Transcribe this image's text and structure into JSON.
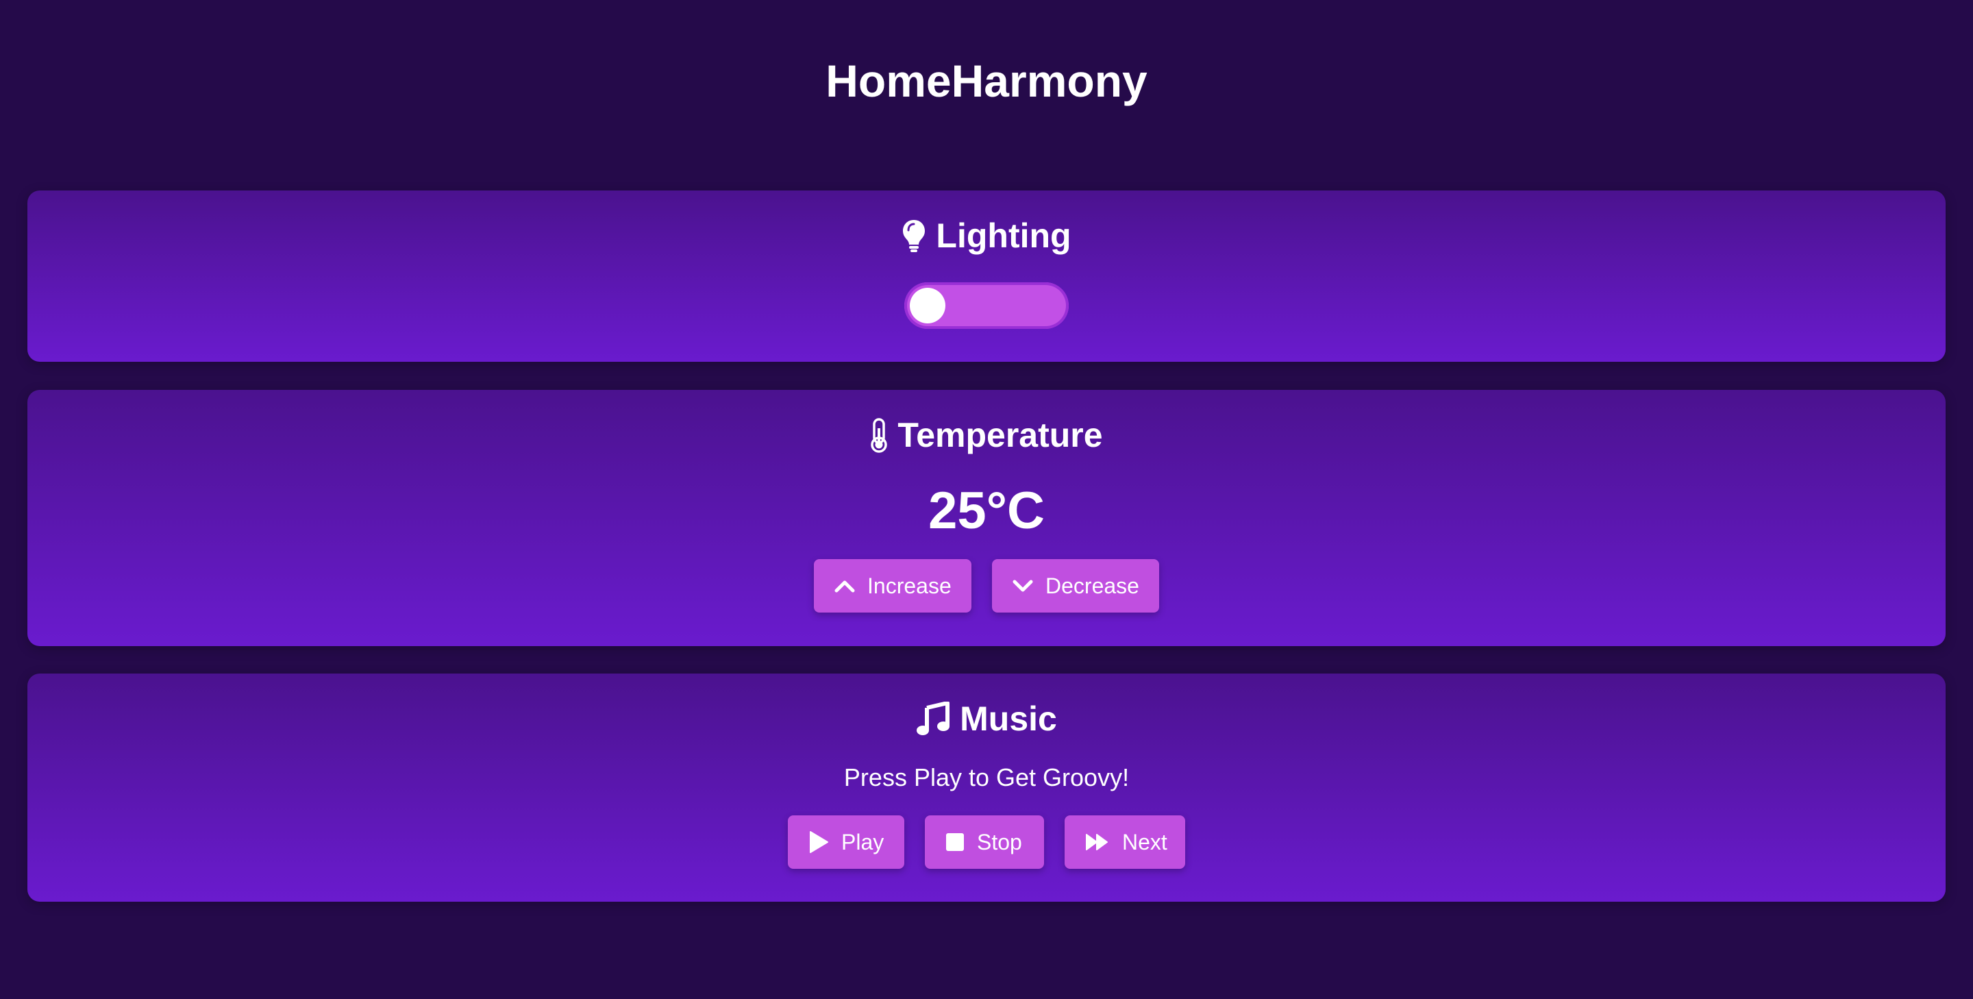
{
  "app": {
    "title": "HomeHarmony"
  },
  "theme": {
    "background": "#250a4a",
    "card_gradient_top": "#4b128f",
    "card_gradient_bottom": "#6a1bce",
    "accent": "#c04fe0"
  },
  "lighting": {
    "heading": "Lighting",
    "icon": "lightbulb-icon",
    "toggle_on": false
  },
  "temperature": {
    "heading": "Temperature",
    "icon": "thermometer-icon",
    "value": "25°C",
    "increase_label": "Increase",
    "increase_icon": "chevron-up-icon",
    "decrease_label": "Decrease",
    "decrease_icon": "chevron-down-icon"
  },
  "music": {
    "heading": "Music",
    "icon": "music-note-icon",
    "tagline": "Press Play to Get Groovy!",
    "play_label": "Play",
    "play_icon": "play-icon",
    "stop_label": "Stop",
    "stop_icon": "stop-icon",
    "next_label": "Next",
    "next_icon": "forward-icon"
  }
}
